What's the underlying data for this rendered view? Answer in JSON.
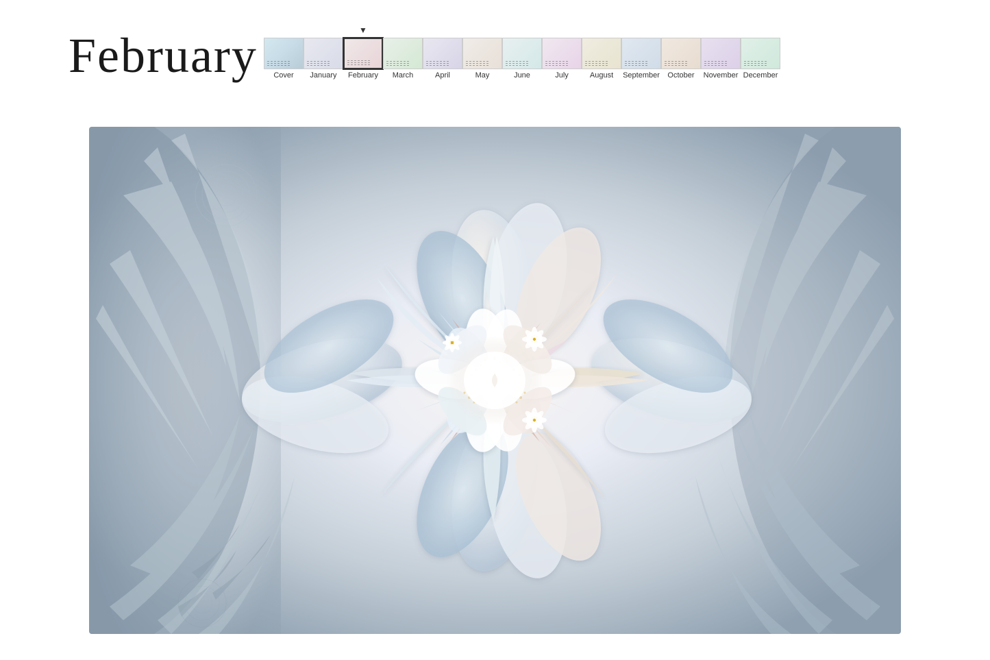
{
  "title": "February",
  "months": [
    {
      "id": "cover",
      "label": "Cover",
      "selected": false,
      "thumbClass": "thumb-cover"
    },
    {
      "id": "january",
      "label": "January",
      "selected": false,
      "thumbClass": "thumb-jan"
    },
    {
      "id": "february",
      "label": "February",
      "selected": true,
      "thumbClass": "thumb-feb"
    },
    {
      "id": "march",
      "label": "March",
      "selected": false,
      "thumbClass": "thumb-mar"
    },
    {
      "id": "april",
      "label": "April",
      "selected": false,
      "thumbClass": "thumb-apr"
    },
    {
      "id": "may",
      "label": "May",
      "selected": false,
      "thumbClass": "thumb-may"
    },
    {
      "id": "june",
      "label": "June",
      "selected": false,
      "thumbClass": "thumb-jun"
    },
    {
      "id": "july",
      "label": "July",
      "selected": false,
      "thumbClass": "thumb-jul"
    },
    {
      "id": "august",
      "label": "August",
      "selected": false,
      "thumbClass": "thumb-aug"
    },
    {
      "id": "september",
      "label": "September",
      "selected": false,
      "thumbClass": "thumb-sep"
    },
    {
      "id": "october",
      "label": "October",
      "selected": false,
      "thumbClass": "thumb-oct"
    },
    {
      "id": "november",
      "label": "November",
      "selected": false,
      "thumbClass": "thumb-nov"
    },
    {
      "id": "december",
      "label": "December",
      "selected": false,
      "thumbClass": "thumb-dec"
    }
  ],
  "colors": {
    "background": "#ffffff",
    "titleText": "#1a1a1a",
    "thumbnailBorder": "#888888",
    "selectedBorder": "#333333"
  }
}
